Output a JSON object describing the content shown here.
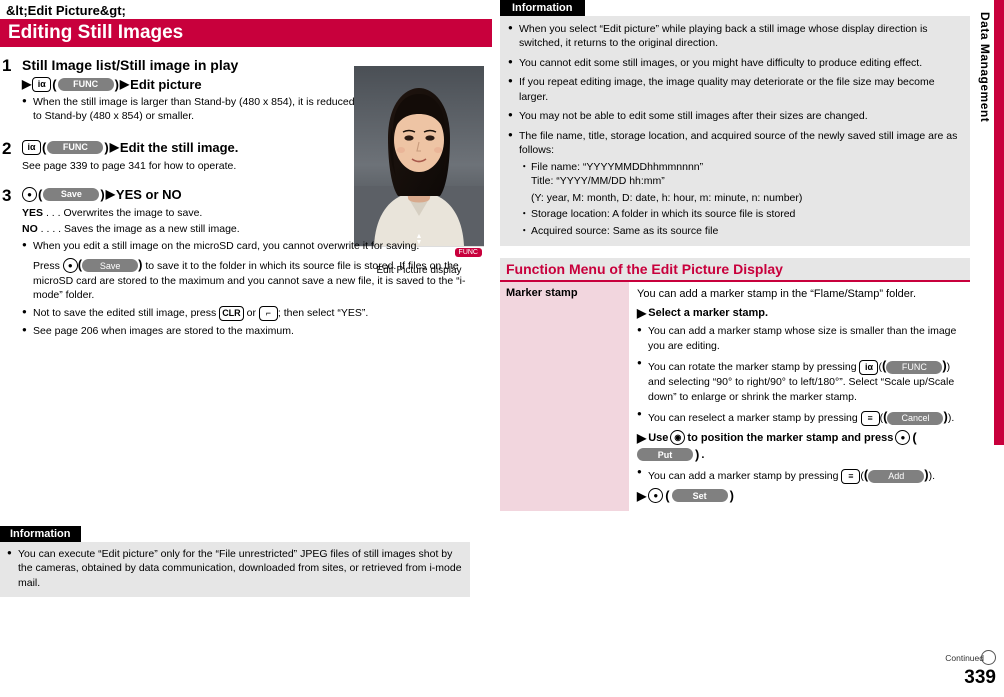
{
  "header": {
    "tag": "&lt;Edit Picture&gt;",
    "title": "Editing Still Images"
  },
  "steps": [
    {
      "num": "1",
      "title": "Still Image list/Still image in play",
      "line": {
        "key": "iα",
        "softkey": "FUNC",
        "arrow": "▶",
        "action": "Edit picture"
      },
      "bullets": [
        "When the still image is larger than Stand-by (480 x 854), it is reduced to Stand-by (480 x 854) or smaller."
      ]
    },
    {
      "num": "2",
      "title": "",
      "line": {
        "key": "iα",
        "softkey": "FUNC",
        "arrow": "▶",
        "action": "Edit the still image."
      },
      "note": "See page 339 to page 341 for how to operate."
    },
    {
      "num": "3",
      "title": "",
      "line": {
        "key": "◉",
        "softkey": "Save",
        "arrow": "▶",
        "action": "YES or NO"
      },
      "defs": [
        {
          "term": "YES",
          "dots": ". . .",
          "text": "Overwrites the image to save."
        },
        {
          "term": "NO",
          "dots": ". . . .",
          "text": "Saves the image as a new still image."
        }
      ],
      "bullets": [
        "When you edit a still image on the microSD card, you cannot overwrite it for saving.",
        "Not to save the edited still image, press @CLR@ or @END@; then select “YES”.",
        "See page 206 when images are stored to the maximum."
      ],
      "press_text_1": "Press ",
      "press_text_2": " to save it to the folder in which its source file is stored. If files on the microSD card are stored to the maximum and you cannot save a new file, it is saved to the “i-mode” folder.",
      "press_softkey": "Save",
      "press_key": "◉",
      "clr_key": "CLR",
      "end_key": "⌐"
    }
  ],
  "picture": {
    "caption": "Edit Picture display",
    "func_tab": "FUNC"
  },
  "left_info": {
    "tab": "Information",
    "bullets": [
      "You can execute “Edit picture” only for the “File unrestricted” JPEG files of still images shot by the cameras, obtained by data communication, downloaded from sites, or retrieved from i-mode mail."
    ]
  },
  "right_info": {
    "tab": "Information",
    "bullets": [
      "When you select “Edit picture” while playing back a still image whose display direction is switched, it returns to the original direction.",
      "You cannot edit some still images, or you might have difficulty to produce editing effect.",
      "If you repeat editing image, the image quality may deteriorate or the file size may become larger.",
      "You may not be able to edit some still images after their sizes are changed.",
      "The file name, title, storage location, and acquired source of the newly saved still image are as follows:"
    ],
    "dashes": [
      "File name: “YYYYMMDDhhmmnnnn”",
      "Title: “YYYY/MM/DD hh:mm”",
      "(Y: year, M: month, D: date, h: hour, m: minute, n: number)",
      "Storage location: A folder in which its source file is stored",
      "Acquired source: Same as its source file"
    ]
  },
  "function_menu": {
    "title": "Function Menu of the Edit Picture Display",
    "rows": [
      {
        "label": "Marker stamp",
        "intro": "You can add a marker stamp in the “Flame/Stamp” folder.",
        "action1": {
          "arrow": "▶",
          "text": "Select a marker stamp."
        },
        "bullets": [
          "You can add a marker stamp whose size is smaller than the image you are editing.",
          "You can rotate the marker stamp by pressing @i@(@FUNC@) and selecting “90° to right/90° to left/180°”. Select “Scale up/Scale down” to enlarge or shrink the marker stamp.",
          "You can reselect a marker stamp by pressing @l@(@Cancel@)."
        ],
        "action2": {
          "arrow": "▶",
          "pre": "Use ",
          "key_mo": "◉",
          "mid": " to position the marker stamp and press ",
          "key_ok": "◉",
          "softkey": "Put",
          "post": "."
        },
        "bullets2": [
          "You can add a marker stamp by pressing @l@(@Add@)."
        ],
        "action3": {
          "arrow": "▶",
          "key": "◉",
          "softkey": "Set"
        }
      }
    ]
  },
  "side": {
    "label": "Data Management",
    "page": "339",
    "continued": "Continued"
  },
  "colors": {
    "accent": "#c8003c",
    "info_bg": "#e6e6e6",
    "fm_label_bg": "#f2d6de"
  }
}
